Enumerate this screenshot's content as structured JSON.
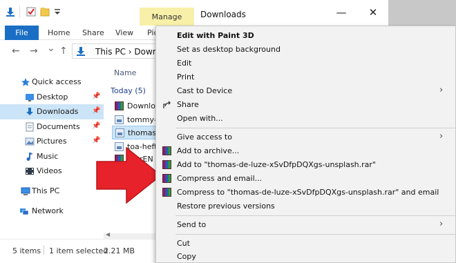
{
  "window": {
    "manage_tab": "Manage",
    "title": "Downloads",
    "minimize_glyph": "—",
    "maximize_glyph": "☐",
    "close_glyph": "✕"
  },
  "ribbon": {
    "file_tab": "File",
    "tabs": [
      "Home",
      "Share",
      "View",
      "Pic"
    ]
  },
  "address": {
    "back": "←",
    "forward": "→",
    "recent": "⌄",
    "up": "↑",
    "path": "This PC  ›  Downlo",
    "separator": "›"
  },
  "navpane": {
    "items": [
      {
        "label": "Quick access",
        "icon": "star-icon"
      },
      {
        "label": "Desktop",
        "icon": "desktop-icon",
        "pinned": true
      },
      {
        "label": "Downloads",
        "icon": "download-icon",
        "pinned": true,
        "selected": true
      },
      {
        "label": "Documents",
        "icon": "documents-icon",
        "pinned": true
      },
      {
        "label": "Pictures",
        "icon": "pictures-icon",
        "pinned": true
      },
      {
        "label": "Music",
        "icon": "music-icon"
      },
      {
        "label": "Videos",
        "icon": "videos-icon"
      },
      {
        "label": "This PC",
        "icon": "computer-icon"
      },
      {
        "label": "Network",
        "icon": "network-icon"
      }
    ],
    "pin_glyph": "📌"
  },
  "filepane": {
    "column_name": "Name",
    "group_header": "Today (5)",
    "files": [
      {
        "name": "Downloa",
        "icon": "rar-icon"
      },
      {
        "name": "tommy-b",
        "icon": "image-icon"
      },
      {
        "name": "thomas-d",
        "icon": "image-icon",
        "selected": true
      },
      {
        "name": "toa-hefti",
        "icon": "image-icon"
      },
      {
        "name": "orarEN",
        "icon": "rar-icon"
      }
    ]
  },
  "statusbar": {
    "items_count": "5 items",
    "selected": "1 item selected",
    "size": "2.21 MB"
  },
  "context_menu": {
    "groups": [
      [
        {
          "label": "Edit with Paint 3D",
          "bold": true
        },
        {
          "label": "Set as desktop background"
        },
        {
          "label": "Edit"
        },
        {
          "label": "Print"
        },
        {
          "label": "Cast to Device",
          "submenu": true
        },
        {
          "label": "Share",
          "icon": "share-icon"
        },
        {
          "label": "Open with..."
        }
      ],
      [
        {
          "label": "Give access to",
          "submenu": true
        },
        {
          "label": "Add to archive...",
          "icon": "winrar-icon"
        },
        {
          "label": "Add to \"thomas-de-luze-xSvDfpDQXgs-unsplash.rar\"",
          "icon": "winrar-icon"
        },
        {
          "label": "Compress and email...",
          "icon": "winrar-icon"
        },
        {
          "label": "Compress to \"thomas-de-luze-xSvDfpDQXgs-unsplash.rar\" and email",
          "icon": "winrar-icon"
        },
        {
          "label": "Restore previous versions"
        }
      ],
      [
        {
          "label": "Send to",
          "submenu": true
        }
      ],
      [
        {
          "label": "Cut"
        },
        {
          "label": "Copy"
        }
      ]
    ],
    "submenu_glyph": "›"
  },
  "colors": {
    "accent": "#1a6fc4",
    "selection": "#cce4f7",
    "manage_tab": "#f8f0a8",
    "annotation_arrow": "#e8222a",
    "menu_background": "#f2f2f2"
  }
}
